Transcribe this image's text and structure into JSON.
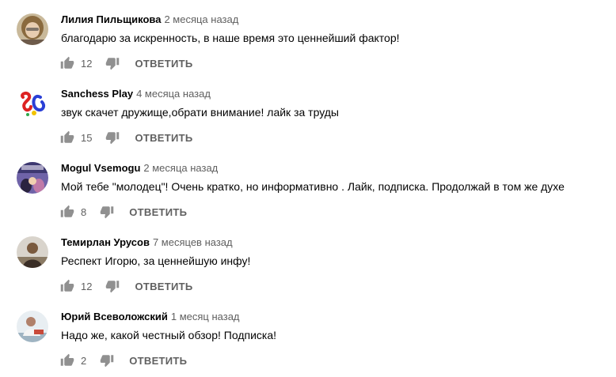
{
  "comments": [
    {
      "author": "Лилия Пильщикова",
      "time": "2 месяца назад",
      "text": "благодарю за искренность, в наше время это ценнейший фактор!",
      "likes": "12",
      "reply_label": "ОТВЕТИТЬ"
    },
    {
      "author": "Sanchess Play",
      "time": "4 месяца назад",
      "text": "звук скачет дружище,обрати внимание! лайк за труды",
      "likes": "15",
      "reply_label": "ОТВЕТИТЬ"
    },
    {
      "author": "Mogul Vsemogu",
      "time": "2 месяца назад",
      "text": "Мой тебе \"молодец\"! Очень кратко, но информативно . Лайк, подписка. Продолжай в том же духе",
      "likes": "8",
      "reply_label": "ОТВЕТИТЬ"
    },
    {
      "author": "Темирлан Урусов",
      "time": "7 месяцев назад",
      "text": "Респект Игорю, за ценнейшую инфу!",
      "likes": "12",
      "reply_label": "ОТВЕТИТЬ"
    },
    {
      "author": "Юрий Всеволожский",
      "time": "1 месяц назад",
      "text": "Надо же, какой честный обзор! Подписка!",
      "likes": "2",
      "reply_label": "ОТВЕТИТЬ"
    }
  ],
  "icons": {
    "like": "thumb-up-icon",
    "dislike": "thumb-down-icon"
  },
  "colors": {
    "text": "#030303",
    "secondary": "#606060",
    "icon": "#909090"
  }
}
